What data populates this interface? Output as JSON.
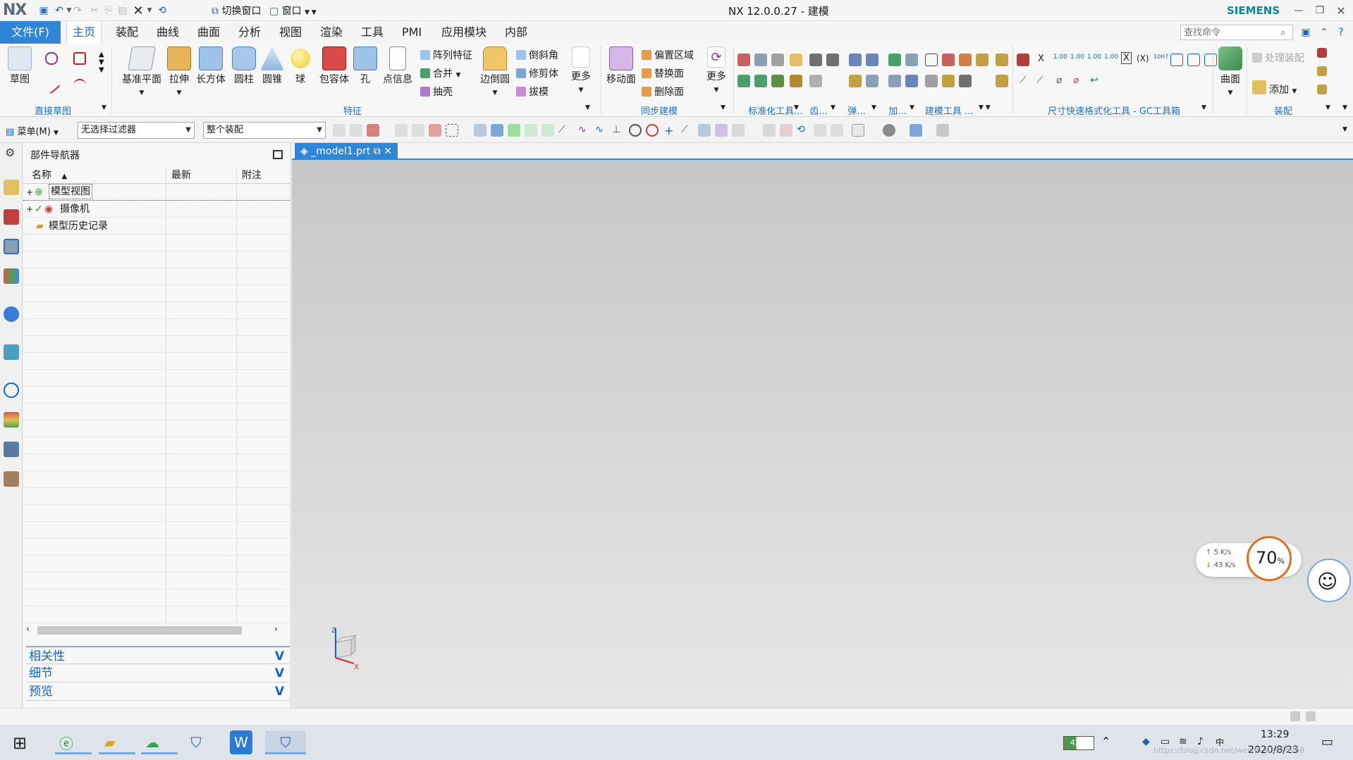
{
  "titlebar": {
    "logo": "NX",
    "title": "NX 12.0.0.27 - 建模",
    "brand": "SIEMENS",
    "switch_window": "切换窗口",
    "window": "窗口"
  },
  "menubar": {
    "file": "文件(F)",
    "tabs": [
      "主页",
      "装配",
      "曲线",
      "曲面",
      "分析",
      "视图",
      "渲染",
      "工具",
      "PMI",
      "应用模块",
      "内部"
    ],
    "search_placeholder": "查找命令"
  },
  "ribbon": {
    "sketch_label": "草图",
    "direct_sketch": "直接草图",
    "feature_buttons": [
      "基准平面",
      "拉伸",
      "长方体",
      "圆柱",
      "圆锥",
      "球",
      "包容体",
      "孔",
      "点信息"
    ],
    "feature_small": [
      "阵列特征",
      "合并",
      "抽壳"
    ],
    "edge_blend": "边倒圆",
    "edge_small": [
      "倒斜角",
      "修剪体",
      "拔模"
    ],
    "more1": "更多",
    "feature_group": "特征",
    "move_face": "移动面",
    "sync_small": [
      "偏置区域",
      "替换面",
      "删除面"
    ],
    "more2": "更多",
    "sync_group": "同步建模",
    "std_tools": "标准化工具...",
    "gear": "齿...",
    "spring": "弹...",
    "add": "加...",
    "modeling_tools": "建模工具 ...",
    "dim_tools": "尺寸快速格式化工具 - GC工具箱",
    "surface": "曲面",
    "process_assembly": "处理装配",
    "add_btn": "添加",
    "assembly_group": "装配"
  },
  "selbar": {
    "menu": "菜单(M)",
    "filter": "无选择过滤器",
    "scope": "整个装配"
  },
  "navigator": {
    "title": "部件导航器",
    "columns": [
      "名称",
      "最新",
      "附注"
    ],
    "items": [
      "模型视图",
      "摄像机",
      "模型历史记录"
    ],
    "sections": [
      "相关性",
      "细节",
      "预览"
    ]
  },
  "doc_tab": "_model1.prt",
  "triad": {
    "z": "Z",
    "x": "X"
  },
  "netmeter": {
    "up": "5",
    "down": "43",
    "unit": "K/s",
    "percent": "70",
    "percent_sign": "%"
  },
  "taskbar": {
    "battery": "42%",
    "time": "13:29",
    "date": "2020/8/23",
    "watermark": "https://blog.csdn.net/weixin_43925768"
  }
}
